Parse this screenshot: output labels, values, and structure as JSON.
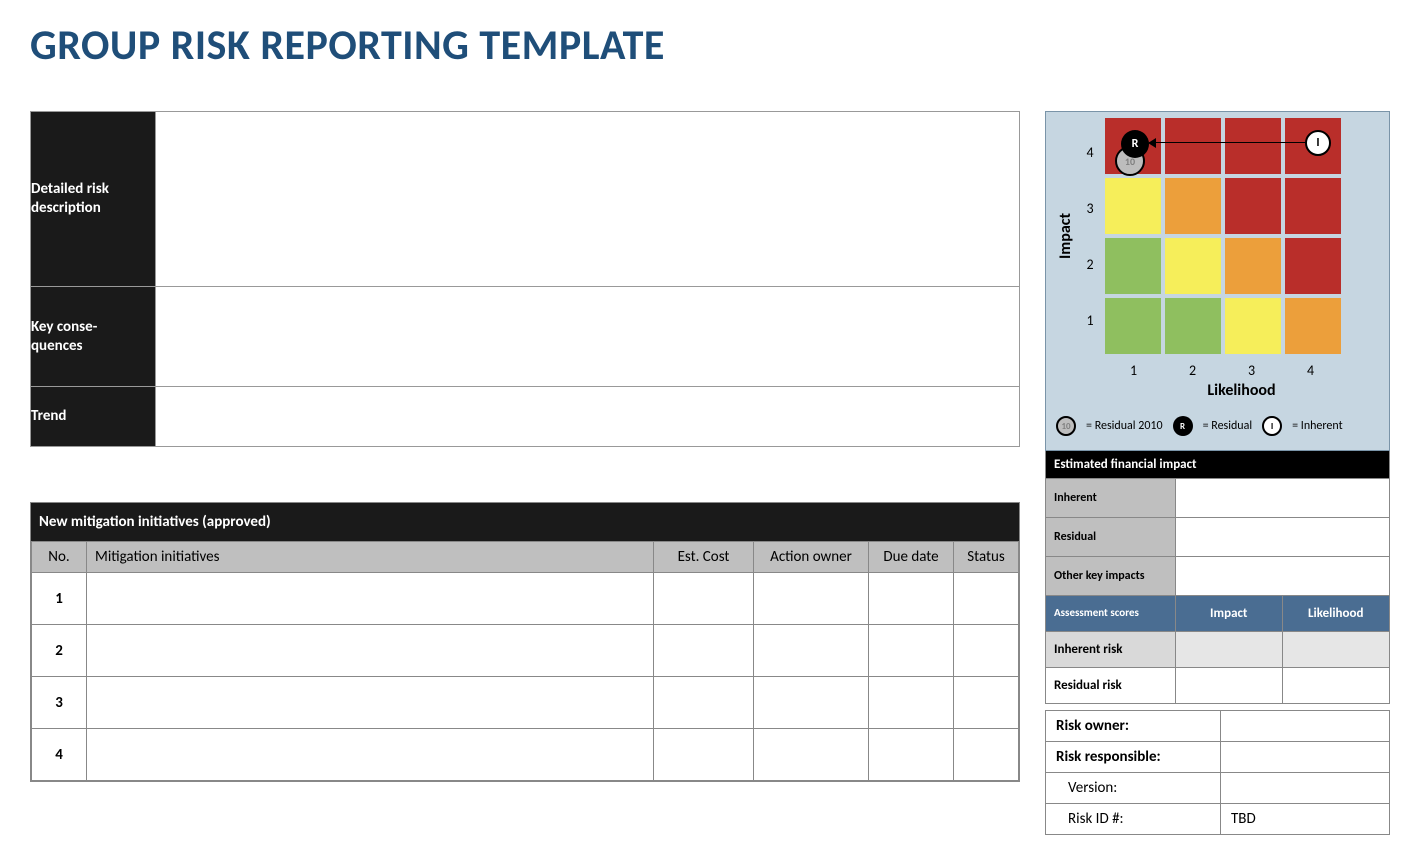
{
  "title": "GROUP RISK REPORTING TEMPLATE",
  "desc_rows": [
    {
      "label": "Detailed risk description",
      "value": ""
    },
    {
      "label": "Key conse-\nquences",
      "value": ""
    },
    {
      "label": "Trend",
      "value": ""
    }
  ],
  "mitigation": {
    "header": "New mitigation initiatives (approved)",
    "columns": [
      "No.",
      "Mitigation initiatives",
      "Est. Cost",
      "Action owner",
      "Due date",
      "Status"
    ],
    "rows": [
      {
        "no": "1",
        "initiative": "",
        "cost": "",
        "owner": "",
        "due": "",
        "status": ""
      },
      {
        "no": "2",
        "initiative": "",
        "cost": "",
        "owner": "",
        "due": "",
        "status": ""
      },
      {
        "no": "3",
        "initiative": "",
        "cost": "",
        "owner": "",
        "due": "",
        "status": ""
      },
      {
        "no": "4",
        "initiative": "",
        "cost": "",
        "owner": "",
        "due": "",
        "status": ""
      }
    ]
  },
  "heatmap": {
    "ylabel": "Impact",
    "xlabel": "Likelihood",
    "yticks": [
      "1",
      "2",
      "3",
      "4"
    ],
    "xticks": [
      "1",
      "2",
      "3",
      "4"
    ],
    "markers": {
      "prev": {
        "symbol": "10"
      },
      "residual": {
        "symbol": "R"
      },
      "inherent": {
        "symbol": "I"
      }
    },
    "legend": {
      "prev": "= Residual 2010",
      "residual": "= Residual",
      "inherent": "= Inherent"
    }
  },
  "chart_data": {
    "type": "heatmap",
    "xlabel": "Likelihood",
    "ylabel": "Impact",
    "x": [
      1,
      2,
      3,
      4
    ],
    "y": [
      1,
      2,
      3,
      4
    ],
    "grid_colors_by_row_top_down": [
      [
        "red",
        "red",
        "red",
        "red"
      ],
      [
        "yellow",
        "orange",
        "red",
        "red"
      ],
      [
        "green",
        "yellow",
        "orange",
        "red"
      ],
      [
        "green",
        "green",
        "yellow",
        "orange"
      ]
    ],
    "points": [
      {
        "name": "Residual 2010",
        "symbol": "10",
        "likelihood": 1,
        "impact": 4
      },
      {
        "name": "Residual",
        "symbol": "R",
        "likelihood": 1,
        "impact": 4
      },
      {
        "name": "Inherent",
        "symbol": "I",
        "likelihood": 4,
        "impact": 4
      }
    ],
    "arrow": {
      "from": "Inherent",
      "to": "Residual"
    }
  },
  "financial": {
    "header": "Estimated financial impact",
    "rows": [
      {
        "label": "Inherent",
        "value": ""
      },
      {
        "label": "Residual",
        "value": ""
      },
      {
        "label": "Other key impacts",
        "value": ""
      }
    ]
  },
  "assessment": {
    "header_cells": [
      "Assessment scores",
      "Impact",
      "Likelihood"
    ],
    "rows": [
      {
        "label": "Inherent risk",
        "impact": "",
        "likelihood": "",
        "cls": "inh"
      },
      {
        "label": "Residual risk",
        "impact": "",
        "likelihood": "",
        "cls": "res"
      }
    ]
  },
  "meta": {
    "owner_label": "Risk owner:",
    "owner_value": "",
    "responsible_label": "Risk responsible:",
    "responsible_value": "",
    "version_label": "Version:",
    "version_value": "",
    "riskid_label": "Risk ID #:",
    "riskid_value": "TBD"
  }
}
